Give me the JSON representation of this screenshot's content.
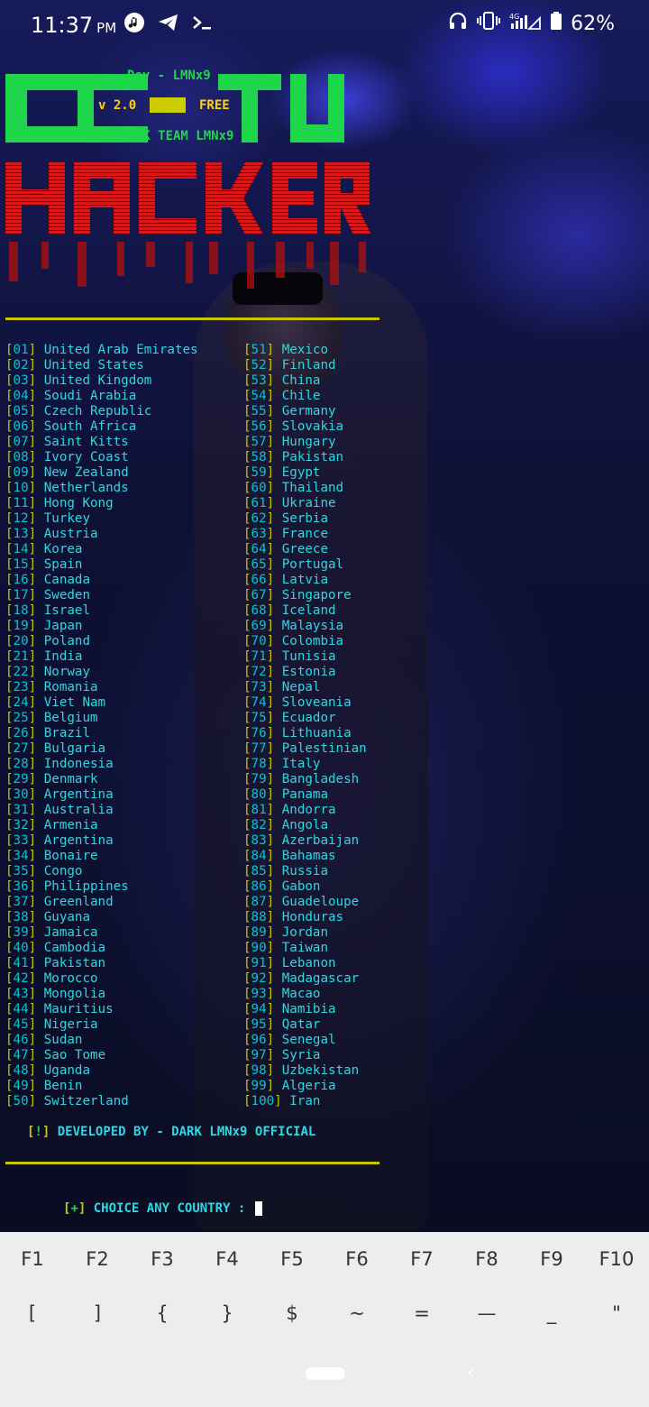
{
  "status_bar": {
    "time": "11:37",
    "ampm": "PM",
    "battery": "62%",
    "network": "4G"
  },
  "banner": {
    "dev": "Dev - LMNx9",
    "version": "v 2.0",
    "free": "FREE",
    "team": "DARK TEAM LMNx9",
    "logo_top": "CCTV",
    "logo_bottom": "HACKER"
  },
  "countries_left": [
    [
      "01",
      "United Arab Emirates"
    ],
    [
      "02",
      "United States"
    ],
    [
      "03",
      "United Kingdom"
    ],
    [
      "04",
      "Soudi Arabia"
    ],
    [
      "05",
      "Czech Republic"
    ],
    [
      "06",
      "South Africa"
    ],
    [
      "07",
      "Saint Kitts"
    ],
    [
      "08",
      "Ivory Coast"
    ],
    [
      "09",
      "New Zealand"
    ],
    [
      "10",
      "Netherlands"
    ],
    [
      "11",
      "Hong Kong"
    ],
    [
      "12",
      "Turkey"
    ],
    [
      "13",
      "Austria"
    ],
    [
      "14",
      "Korea"
    ],
    [
      "15",
      "Spain"
    ],
    [
      "16",
      "Canada"
    ],
    [
      "17",
      "Sweden"
    ],
    [
      "18",
      "Israel"
    ],
    [
      "19",
      "Japan"
    ],
    [
      "20",
      "Poland"
    ],
    [
      "21",
      "India"
    ],
    [
      "22",
      "Norway"
    ],
    [
      "23",
      "Romania"
    ],
    [
      "24",
      "Viet Nam"
    ],
    [
      "25",
      "Belgium"
    ],
    [
      "26",
      "Brazil"
    ],
    [
      "27",
      "Bulgaria"
    ],
    [
      "28",
      "Indonesia"
    ],
    [
      "29",
      "Denmark"
    ],
    [
      "30",
      "Argentina"
    ],
    [
      "31",
      "Australia"
    ],
    [
      "32",
      "Armenia"
    ],
    [
      "33",
      "Argentina"
    ],
    [
      "34",
      "Bonaire"
    ],
    [
      "35",
      "Congo"
    ],
    [
      "36",
      "Philippines"
    ],
    [
      "37",
      "Greenland"
    ],
    [
      "38",
      "Guyana"
    ],
    [
      "39",
      "Jamaica"
    ],
    [
      "40",
      "Cambodia"
    ],
    [
      "41",
      "Pakistan"
    ],
    [
      "42",
      "Morocco"
    ],
    [
      "43",
      "Mongolia"
    ],
    [
      "44",
      "Mauritius"
    ],
    [
      "45",
      "Nigeria"
    ],
    [
      "46",
      "Sudan"
    ],
    [
      "47",
      "Sao Tome"
    ],
    [
      "48",
      "Uganda"
    ],
    [
      "49",
      "Benin"
    ],
    [
      "50",
      "Switzerland"
    ]
  ],
  "countries_right": [
    [
      "51",
      "Mexico"
    ],
    [
      "52",
      "Finland"
    ],
    [
      "53",
      "China"
    ],
    [
      "54",
      "Chile"
    ],
    [
      "55",
      "Germany"
    ],
    [
      "56",
      "Slovakia"
    ],
    [
      "57",
      "Hungary"
    ],
    [
      "58",
      "Pakistan"
    ],
    [
      "59",
      "Egypt"
    ],
    [
      "60",
      "Thailand"
    ],
    [
      "61",
      "Ukraine"
    ],
    [
      "62",
      "Serbia"
    ],
    [
      "63",
      "France"
    ],
    [
      "64",
      "Greece"
    ],
    [
      "65",
      "Portugal"
    ],
    [
      "66",
      "Latvia"
    ],
    [
      "67",
      "Singapore"
    ],
    [
      "68",
      "Iceland"
    ],
    [
      "69",
      "Malaysia"
    ],
    [
      "70",
      "Colombia"
    ],
    [
      "71",
      "Tunisia"
    ],
    [
      "72",
      "Estonia"
    ],
    [
      "73",
      "Nepal"
    ],
    [
      "74",
      "Sloveania"
    ],
    [
      "75",
      "Ecuador"
    ],
    [
      "76",
      "Lithuania"
    ],
    [
      "77",
      "Palestinian"
    ],
    [
      "78",
      "Italy"
    ],
    [
      "79",
      "Bangladesh"
    ],
    [
      "80",
      "Panama"
    ],
    [
      "81",
      "Andorra"
    ],
    [
      "82",
      "Angola"
    ],
    [
      "83",
      "Azerbaijan"
    ],
    [
      "84",
      "Bahamas"
    ],
    [
      "85",
      "Russia"
    ],
    [
      "86",
      "Gabon"
    ],
    [
      "87",
      "Guadeloupe"
    ],
    [
      "88",
      "Honduras"
    ],
    [
      "89",
      "Jordan"
    ],
    [
      "90",
      "Taiwan"
    ],
    [
      "91",
      "Lebanon"
    ],
    [
      "92",
      "Madagascar"
    ],
    [
      "93",
      "Macao"
    ],
    [
      "94",
      "Namibia"
    ],
    [
      "95",
      "Qatar"
    ],
    [
      "96",
      "Senegal"
    ],
    [
      "97",
      "Syria"
    ],
    [
      "98",
      "Uzbekistan"
    ],
    [
      "99",
      "Algeria"
    ],
    [
      "100",
      "Iran"
    ]
  ],
  "footer": {
    "developed_tag": "!",
    "developed_text": "DEVELOPED BY - DARK LMNx9 OFFICIAL",
    "prompt_tag": "+",
    "prompt_text": "CHOICE ANY COUNTRY : "
  },
  "extra_keys": {
    "row1": [
      "F1",
      "F2",
      "F3",
      "F4",
      "F5",
      "F6",
      "F7",
      "F8",
      "F9",
      "F10"
    ],
    "row2": [
      "[",
      "]",
      "{",
      "}",
      "$",
      "~",
      "=",
      "—",
      "_",
      "\""
    ]
  },
  "colors": {
    "green": "#1ed64a",
    "yellow": "#ffd400",
    "red": "#d81818",
    "cyan": "#2fd7e3",
    "rule": "#c9c400"
  }
}
